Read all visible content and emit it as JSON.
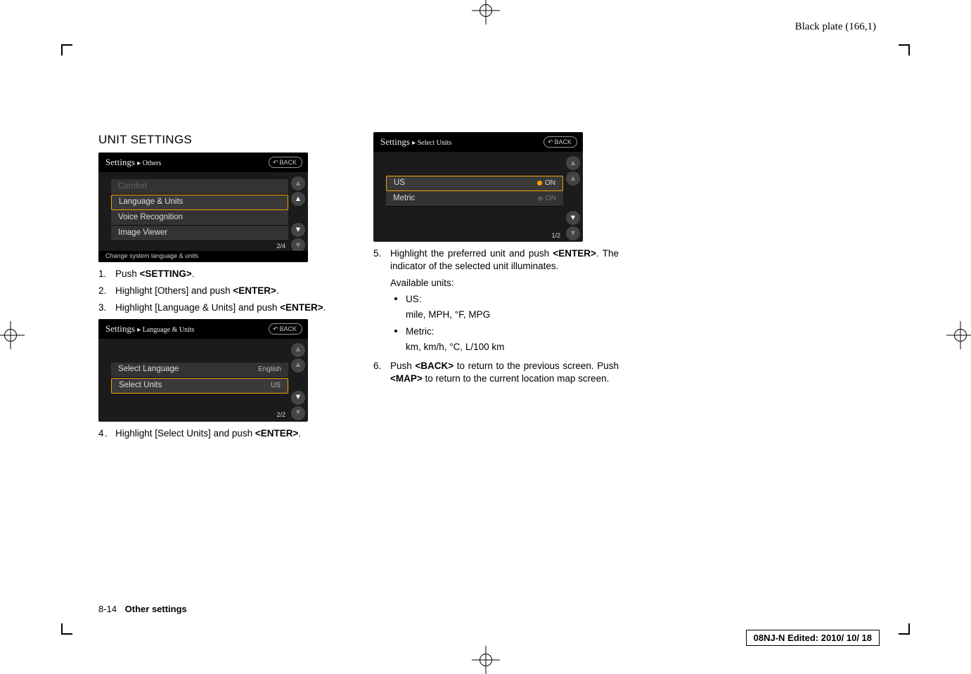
{
  "plate_label": "Black plate (166,1)",
  "title": "UNIT SETTINGS",
  "screenshots": {
    "s1": {
      "breadcrumb_main": "Settings",
      "breadcrumb_sub": "Others",
      "back_label": "BACK",
      "rows": [
        {
          "label": "Comfort",
          "dim": true
        },
        {
          "label": "Language & Units",
          "selected": true
        },
        {
          "label": "Voice Recognition"
        },
        {
          "label": "Image Viewer"
        }
      ],
      "count": "2/4",
      "footer": "Change system language & units"
    },
    "s2": {
      "breadcrumb_main": "Settings",
      "breadcrumb_sub": "Language & Units",
      "back_label": "BACK",
      "rows": [
        {
          "label": "Select Language",
          "value": "English"
        },
        {
          "label": "Select Units",
          "value": "US",
          "selected": true
        }
      ],
      "count": "2/2"
    },
    "s3": {
      "breadcrumb_main": "Settings",
      "breadcrumb_sub": "Select Units",
      "back_label": "BACK",
      "rows": [
        {
          "label": "US",
          "state": "ON",
          "on": true,
          "selected": true
        },
        {
          "label": "Metric",
          "state": "ON",
          "on": false
        }
      ],
      "count": "1/2"
    }
  },
  "steps_col1": {
    "s1": {
      "pre": "Push ",
      "bold": "<SETTING>",
      "post": "."
    },
    "s2": {
      "pre": "Highlight [Others] and push ",
      "bold": "<ENTER>",
      "post": "."
    },
    "s3": {
      "pre": "Highlight [Language & Units] and push ",
      "bold": "<ENTER>",
      "post": "."
    },
    "s4": {
      "pre": "Highlight [Select Units] and push ",
      "bold": "<ENTER>",
      "post": "."
    }
  },
  "steps_col2": {
    "s5": {
      "pre": "Highlight the preferred unit and push ",
      "bold": "<ENTER>",
      "post": ". The indicator of the selected unit illuminates."
    },
    "available": "Available units:",
    "us_label": "US:",
    "us_detail": "mile, MPH, °F, MPG",
    "metric_label": "Metric:",
    "metric_detail": "km, km/h, °C, L/100 km",
    "s6": {
      "pre1": "Push ",
      "bold1": "<BACK>",
      "mid": " to return to the previous screen. Push ",
      "bold2": "<MAP>",
      "post": " to return to the current location map screen."
    }
  },
  "page_foot": {
    "num": "8-14",
    "section": "Other settings"
  },
  "edit_box": "08NJ-N Edited:  2010/ 10/ 18"
}
